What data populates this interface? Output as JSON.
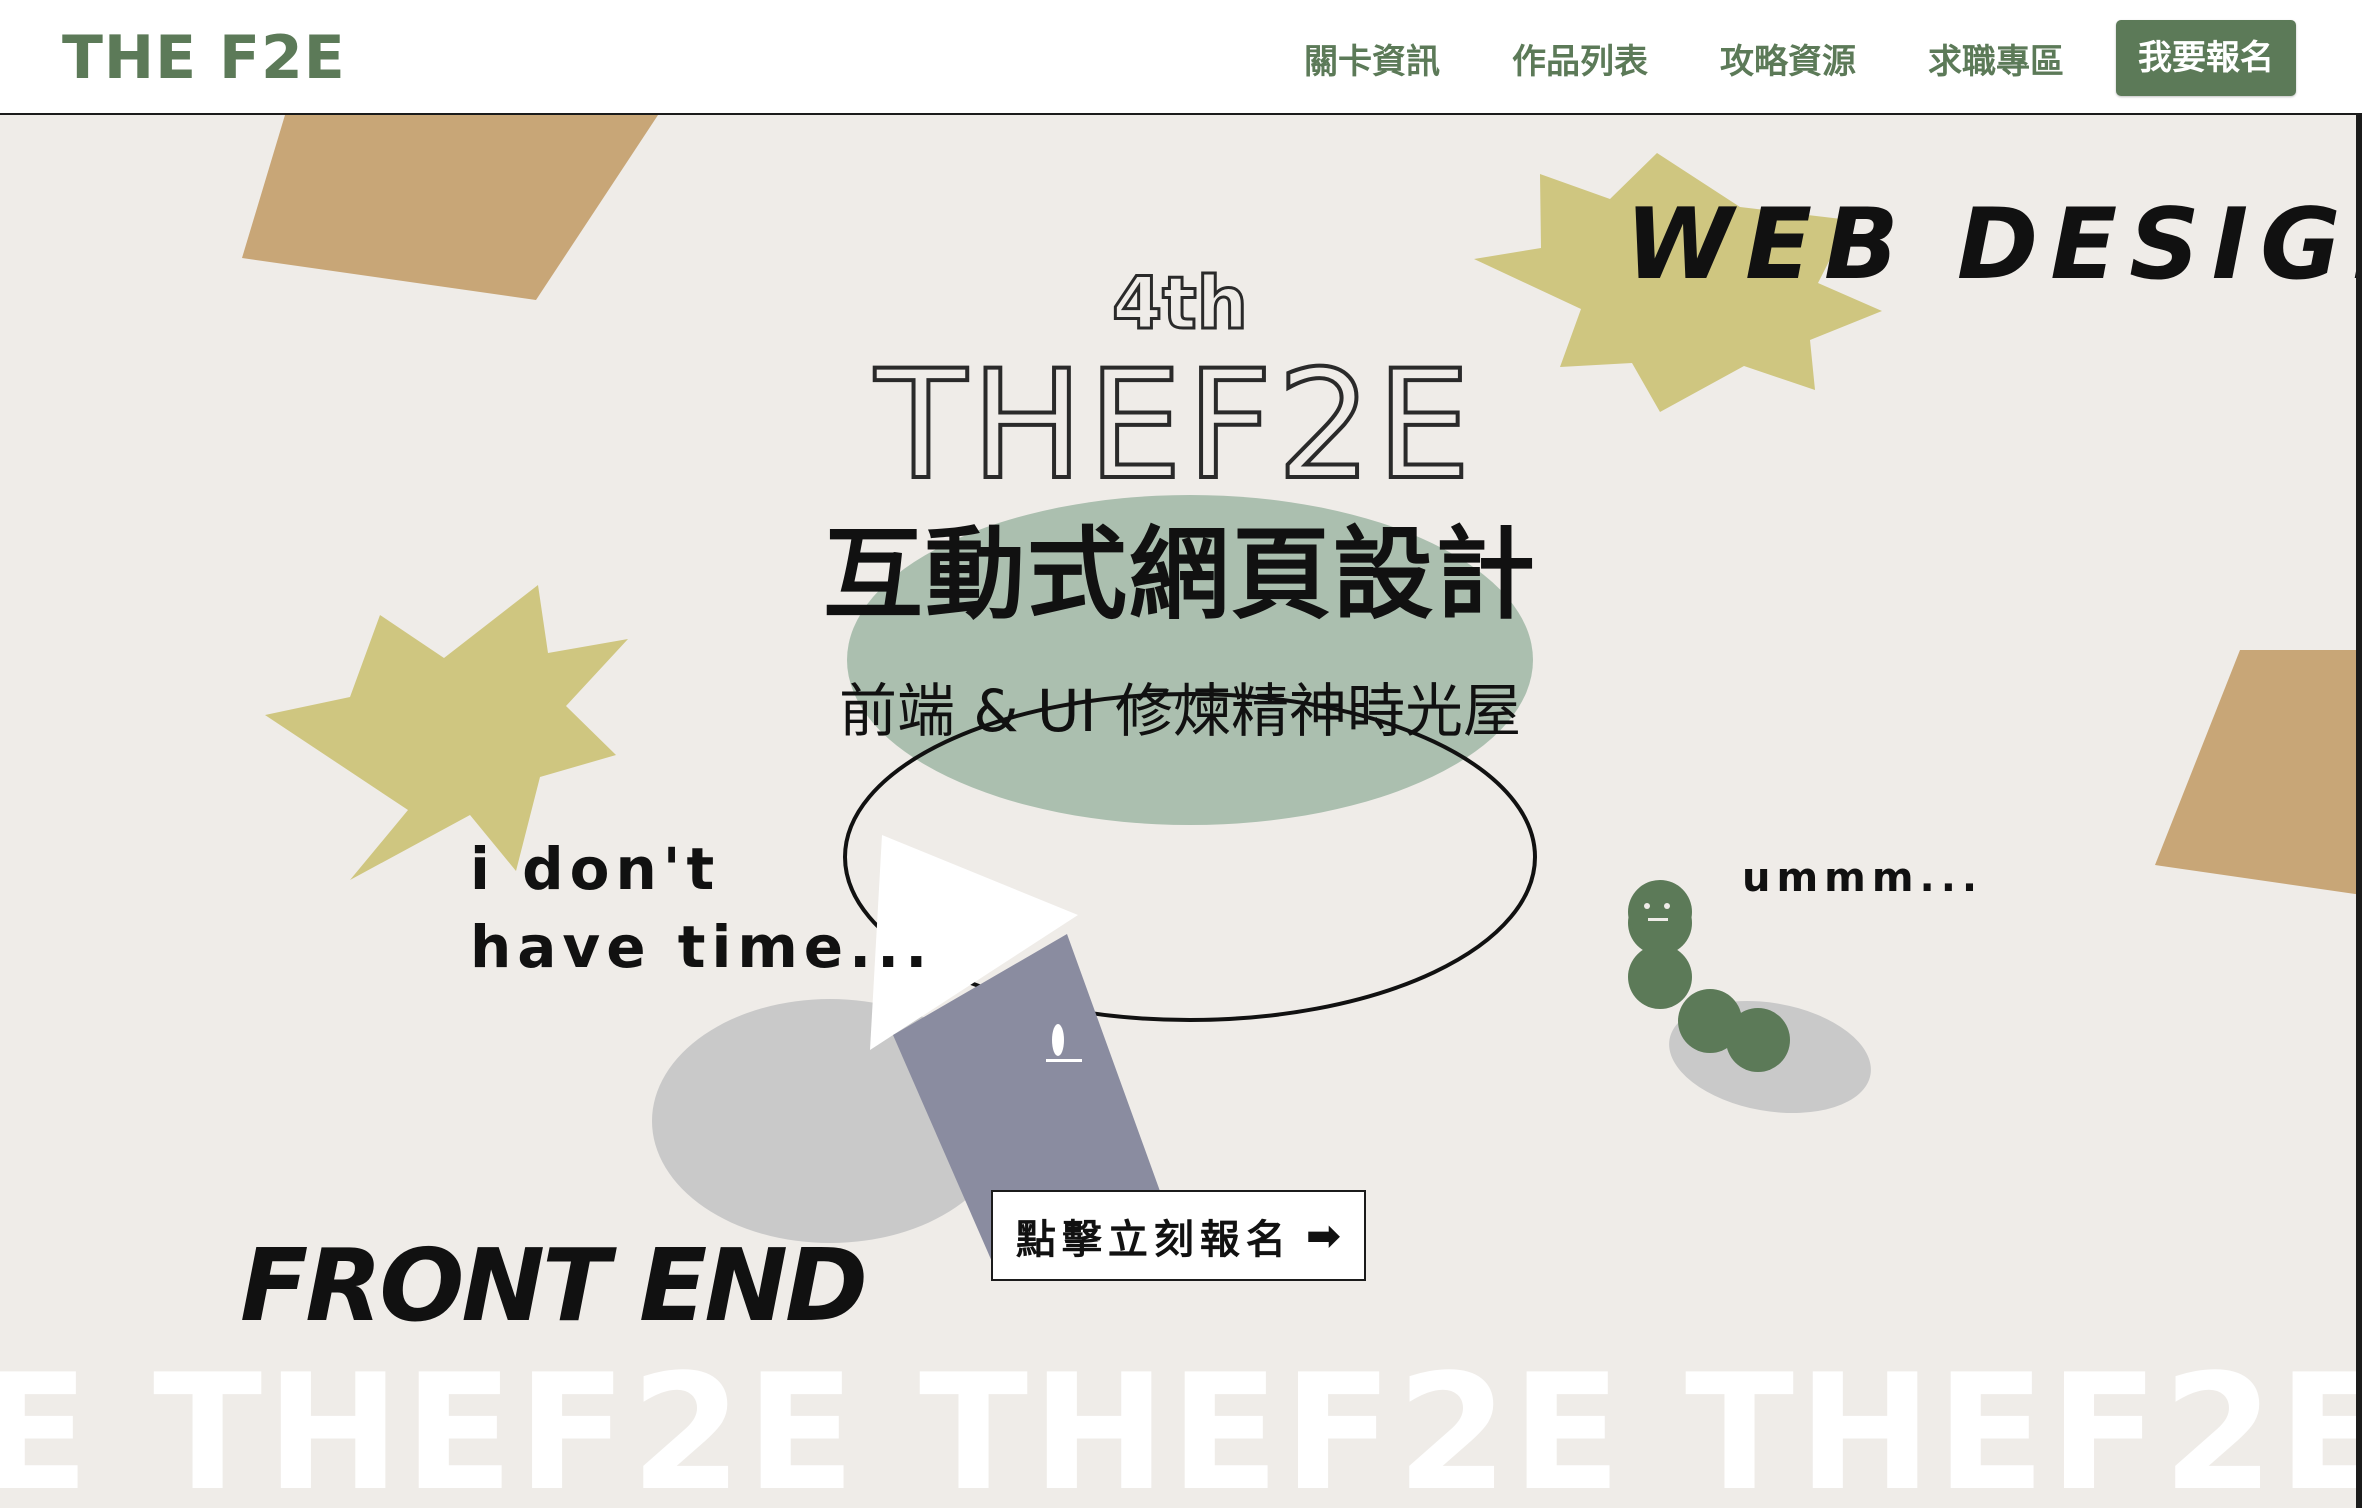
{
  "header": {
    "logo": "THE F2E",
    "nav": [
      {
        "label": "關卡資訊"
      },
      {
        "label": "作品列表"
      },
      {
        "label": "攻略資源"
      },
      {
        "label": "求職專區"
      }
    ],
    "cta": "我要報名"
  },
  "hero": {
    "edition": "4th",
    "event_name": "THEF2E",
    "title": "互動式網頁設計",
    "subtitle": "前端 & UI 修煉精神時光屋",
    "tag_web_design": "WEB DESIGN",
    "tag_front_end": "FRONT END",
    "quote_left": [
      "i don't",
      "have time..."
    ],
    "quote_right": "ummm...",
    "cta_label": "點擊立刻報名",
    "cta_arrow": "➡",
    "marquee": "E THEF2E THEF2E THEF2E THE"
  },
  "colors": {
    "brand_green": "#5c7a58",
    "background": "#efece8",
    "star_yellow": "#cfc680",
    "shape_tan": "#c8a677",
    "ellipse_sage": "#abbfaf",
    "block_slate": "#8a8ca0",
    "shadow_gray": "#c9c9c9"
  }
}
